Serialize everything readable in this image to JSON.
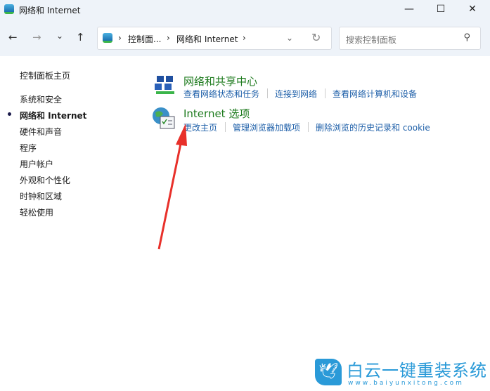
{
  "window": {
    "title": "网络和 Internet",
    "minimize": "—",
    "maximize": "☐",
    "close": "✕"
  },
  "nav": {
    "back": "←",
    "forward": "→",
    "recent": "⌄",
    "up": "↑",
    "breadcrumb": [
      "控制面...",
      "网络和 Internet"
    ],
    "sep": "›",
    "dropdown": "⌄",
    "refresh": "↻",
    "search_placeholder": "搜索控制面板",
    "search_icon": "⚲"
  },
  "sidebar": {
    "items": [
      {
        "label": "控制面板主页"
      },
      {
        "label": "系统和安全"
      },
      {
        "label": "网络和 Internet",
        "current": true
      },
      {
        "label": "硬件和声音"
      },
      {
        "label": "程序"
      },
      {
        "label": "用户帐户"
      },
      {
        "label": "外观和个性化"
      },
      {
        "label": "时钟和区域"
      },
      {
        "label": "轻松使用"
      }
    ]
  },
  "categories": [
    {
      "title": "网络和共享中心",
      "icon": "network-icon",
      "links": [
        "查看网络状态和任务",
        "连接到网络",
        "查看网络计算机和设备"
      ]
    },
    {
      "title": "Internet 选项",
      "icon": "internet-options-icon",
      "links": [
        "更改主页",
        "管理浏览器加载项",
        "删除浏览的历史记录和 cookie"
      ]
    }
  ],
  "watermark": {
    "name": "白云一键重装系统",
    "url": "www.baiyunxitong.com"
  },
  "colors": {
    "link": "#1c5ea8",
    "category": "#1e7b1e",
    "arrow": "#e8302a",
    "chrome": "#eef3f9"
  }
}
